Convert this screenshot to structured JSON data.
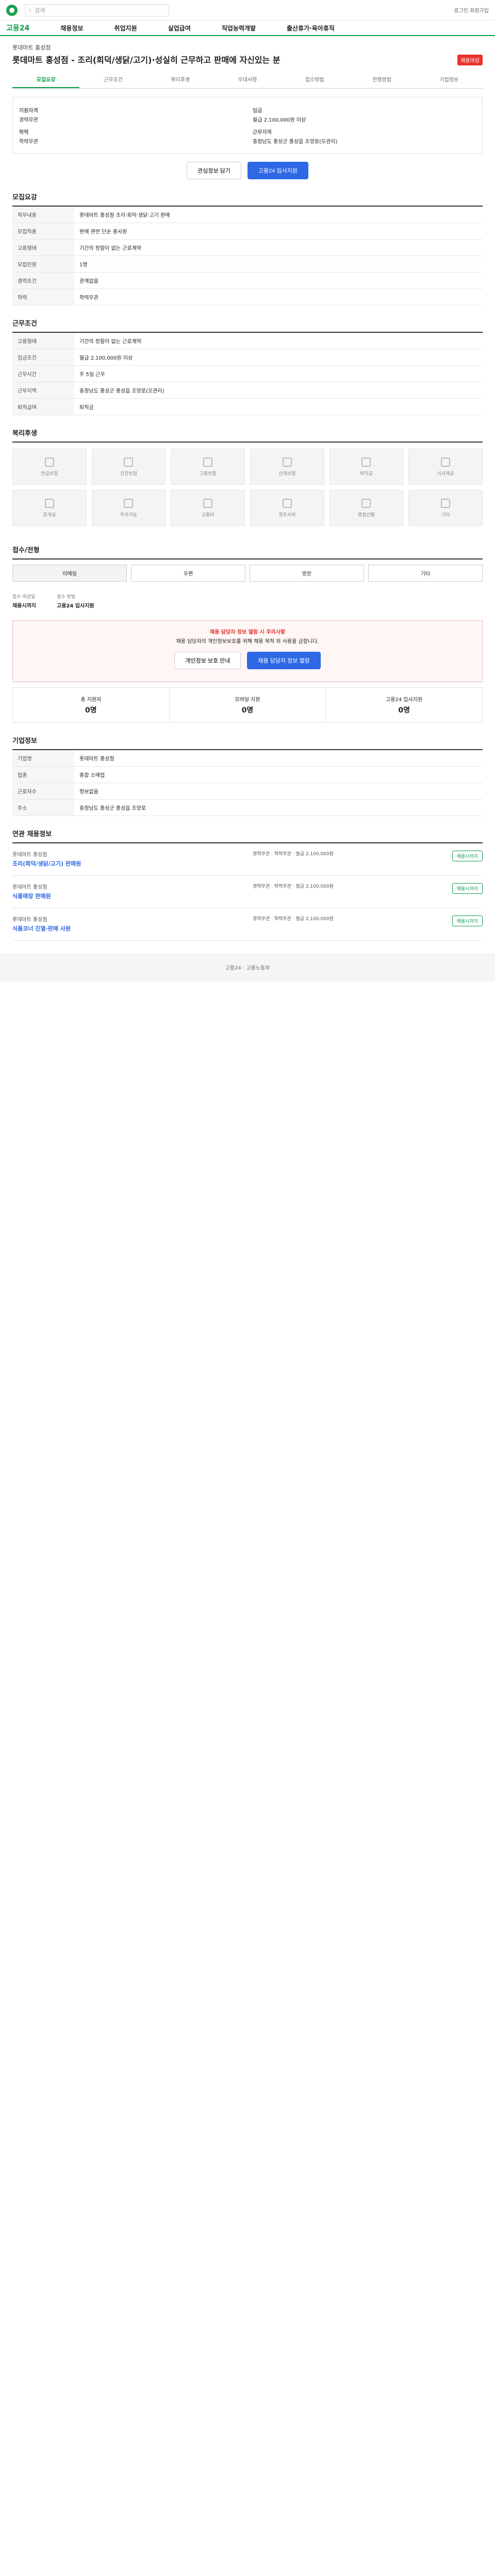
{
  "header": {
    "brand": "고용24",
    "search_placeholder": "검색",
    "links": "로그인 회원가입"
  },
  "gnb": [
    "채용정보",
    "취업지원",
    "실업급여",
    "직업능력개발",
    "출산휴가·육아휴직"
  ],
  "job": {
    "company": "롯데마트 홍성점",
    "title": "롯데마트 홍성점 - 조리(회덕/생닭/고기)·성실히 근무하고 판매에 자신있는 분",
    "badge": "채용마감"
  },
  "tabs": [
    "모집요강",
    "근무조건",
    "복리후생",
    "우대사항",
    "접수방법",
    "전형방법",
    "기업정보"
  ],
  "summary": {
    "exp_label": "지원자격",
    "exp": "경력무관",
    "edu_label": "학력",
    "edu": "학력무관",
    "pay_label": "임금",
    "pay": "월급 2,100,000원 이상",
    "loc_label": "근무지역",
    "loc": "충청남도 홍성군 홍성읍 조양로(오관리)"
  },
  "actions": {
    "interest": "관심정보 담기",
    "apply": "고용24 입사지원"
  },
  "sections": {
    "recruit": "모집요강",
    "work": "근무조건",
    "welfare": "복리후생",
    "prefer": "우대사항",
    "apply": "접수/전형",
    "process": "전형방법",
    "company": "기업정보",
    "related": "연관 채용정보"
  },
  "recruit_rows": [
    [
      "직무내용",
      "롯데마트 홍성점 조리·회덕·생닭·고기 판매"
    ],
    [
      "모집직종",
      "판매 관련 단순 종사원"
    ],
    [
      "고용형태",
      "기간의 정함이 없는 근로계약"
    ],
    [
      "모집인원",
      "1명"
    ],
    [
      "경력조건",
      "관계없음"
    ],
    [
      "학력",
      "학력무관"
    ]
  ],
  "work_rows": [
    [
      "고용형태",
      "기간의 정함이 없는 근로계약"
    ],
    [
      "임금조건",
      "월급 2,100,000원 이상"
    ],
    [
      "근무시간",
      "주 5일 근무"
    ],
    [
      "근무지역",
      "충청남도 홍성군 홍성읍 조양로(오관리)"
    ],
    [
      "퇴직급여",
      "퇴직금"
    ]
  ],
  "welfare": [
    "연금보험",
    "건강보험",
    "고용보험",
    "산재보험",
    "퇴직금",
    "식사제공",
    "휴게실",
    "주차가능",
    "교통비",
    "경조사비",
    "명절선물",
    "기타"
  ],
  "apply": {
    "deadline_label": "접수 마감일",
    "deadline": "채용시까지",
    "method_label": "접수 방법",
    "method": "고용24 입사지원",
    "tabs": [
      "이메일",
      "우편",
      "방문",
      "기타"
    ]
  },
  "warning": {
    "head": "채용 담당자 정보 열람 시 주의사항",
    "body": "채용 담당자의 개인정보보호를 위해 채용 목적 외 사용을 금합니다.",
    "b1": "채용 담당자 정보 열람",
    "b2": "개인정보 보호 안내"
  },
  "stats": [
    [
      "총 지원자",
      "0명"
    ],
    [
      "모바일 지원",
      "0명"
    ],
    [
      "고용24 입사지원",
      "0명"
    ]
  ],
  "company_rows": [
    [
      "기업명",
      "롯데마트 홍성점"
    ],
    [
      "업종",
      "종합 소매업"
    ],
    [
      "근로자수",
      "정보없음"
    ],
    [
      "주소",
      "충청남도 홍성군 홍성읍 조양로"
    ]
  ],
  "related": [
    {
      "c": "롯데마트 홍성점",
      "t": "조리(회덕/생닭/고기) 판매원",
      "m": "경력무관 · 학력무관 · 월급 2,100,000원",
      "r": "채용시까지"
    },
    {
      "c": "롯데마트 홍성점",
      "t": "식품매장 판매원",
      "m": "경력무관 · 학력무관 · 월급 2,100,000원",
      "r": "채용시까지"
    },
    {
      "c": "롯데마트 홍성점",
      "t": "식품코너 진열·판매 사원",
      "m": "경력무관 · 학력무관 · 월급 2,100,000원",
      "r": "채용시까지"
    }
  ],
  "footer": "고용24 · 고용노동부"
}
